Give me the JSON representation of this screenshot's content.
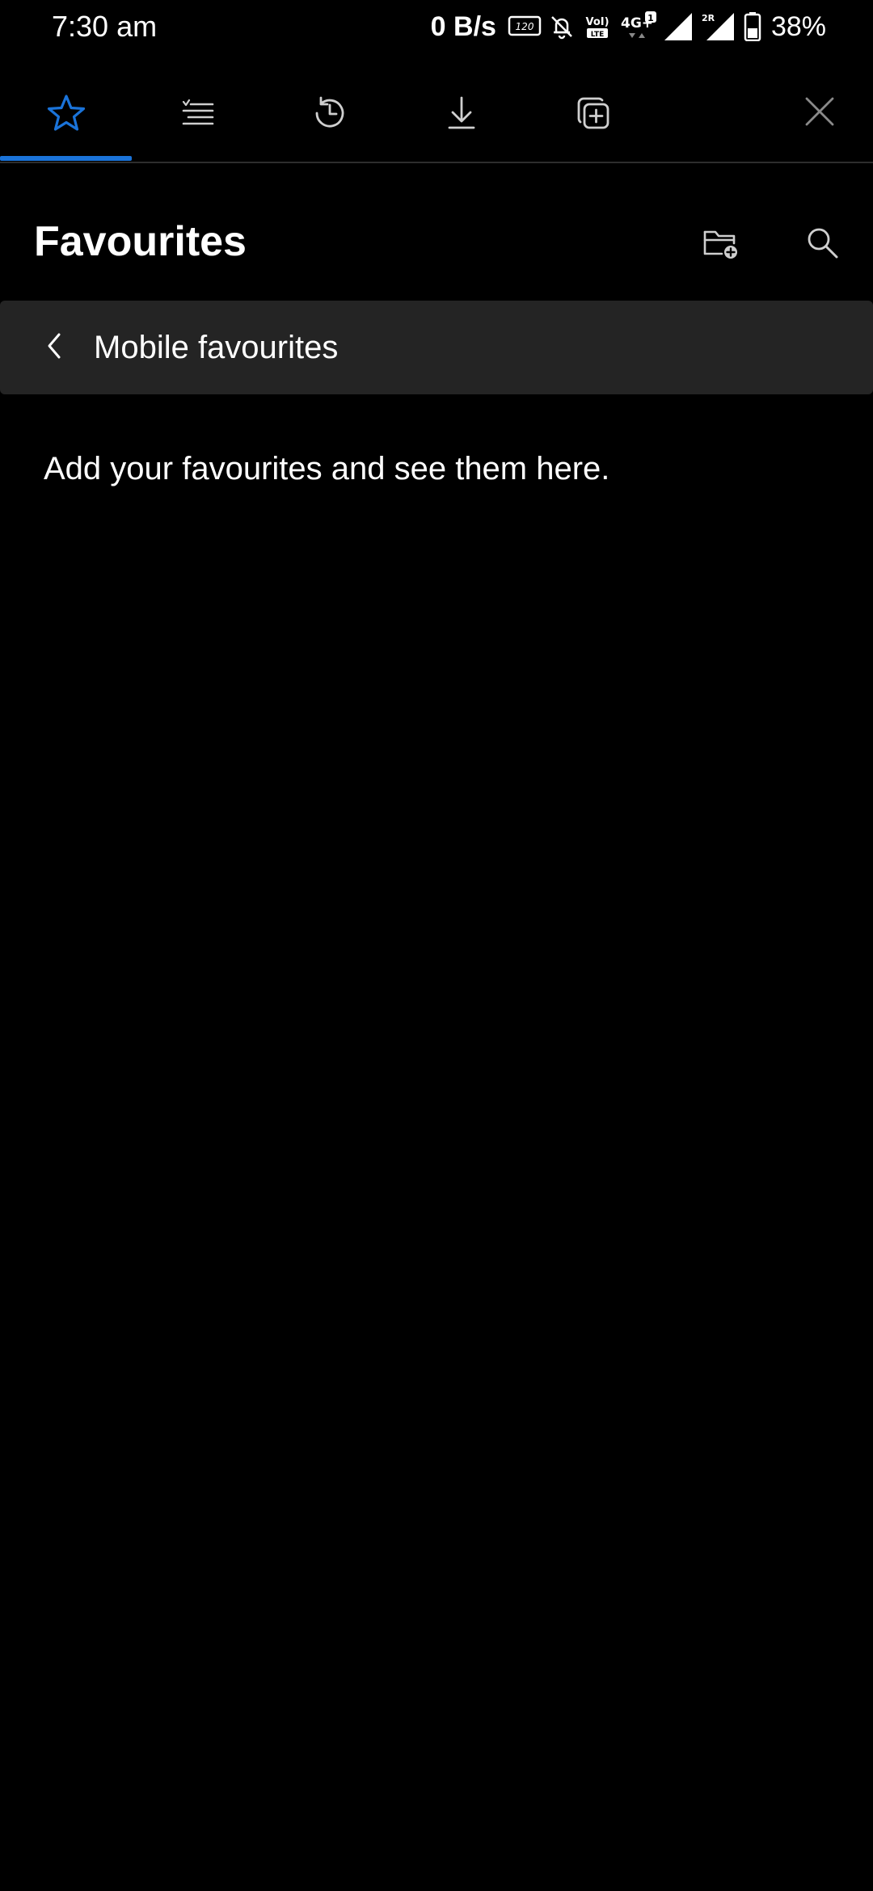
{
  "status_bar": {
    "time": "7:30 am",
    "network_speed": "0 B/s",
    "refresh_badge": "120 Hz",
    "network_type": "4G+",
    "sim1_badge": "1",
    "sim2_badge": "2R",
    "battery_percent": "38%",
    "icons": [
      "refresh-rate-icon",
      "muted-bell-icon",
      "volte-icon",
      "signal-icon",
      "signal-icon",
      "battery-icon"
    ]
  },
  "toolbar": {
    "active_tab": "favourites",
    "accent_color": "#1a73d9",
    "tabs": [
      {
        "id": "favourites",
        "icon": "star-icon"
      },
      {
        "id": "reading-list",
        "icon": "reading-list-icon"
      },
      {
        "id": "history",
        "icon": "history-icon"
      },
      {
        "id": "downloads",
        "icon": "download-icon"
      },
      {
        "id": "collections",
        "icon": "collections-icon"
      }
    ],
    "close_icon": "close-icon"
  },
  "header": {
    "title": "Favourites",
    "actions": [
      {
        "id": "add-folder",
        "icon": "add-folder-icon"
      },
      {
        "id": "search",
        "icon": "search-icon"
      }
    ]
  },
  "breadcrumb": {
    "back_icon": "chevron-left-icon",
    "label": "Mobile favourites"
  },
  "empty_state": {
    "message": "Add your favourites and see them here."
  }
}
